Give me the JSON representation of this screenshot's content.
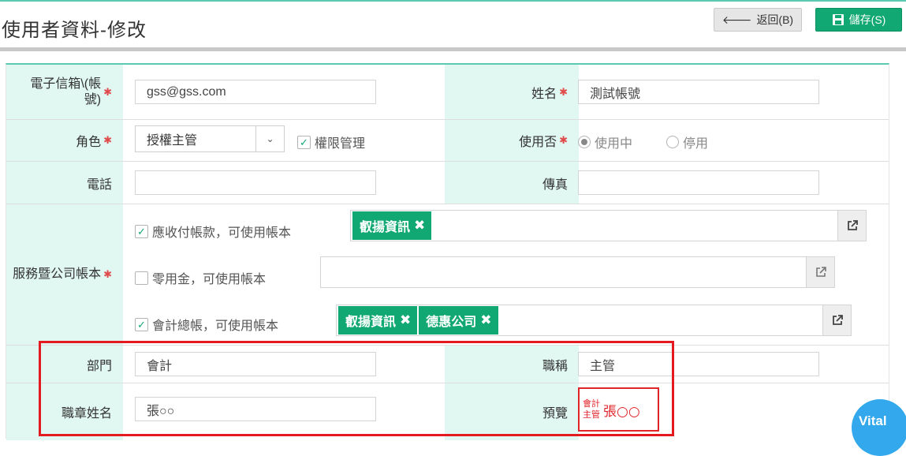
{
  "header": {
    "title": "使用者資料-修改",
    "back_label": "返回(B)",
    "save_label": "儲存(S)"
  },
  "form": {
    "email": {
      "label": "電子信箱\\(帳號)",
      "value": "gss@gss.com"
    },
    "name": {
      "label": "姓名",
      "value": "測試帳號"
    },
    "role": {
      "label": "角色",
      "value": "授權主管",
      "perm_label": "權限管理",
      "perm_checked": true
    },
    "status": {
      "label": "使用否",
      "options": [
        "使用中",
        "停用"
      ],
      "selected": "使用中"
    },
    "phone": {
      "label": "電話",
      "value": ""
    },
    "fax": {
      "label": "傳真",
      "value": ""
    },
    "services": {
      "label": "服務暨公司帳本",
      "items": [
        {
          "label": "應收付帳款，可使用帳本",
          "checked": true,
          "tags": [
            "叡揚資訊"
          ]
        },
        {
          "label": "零用金，可使用帳本",
          "checked": false,
          "tags": []
        },
        {
          "label": "會計總帳，可使用帳本",
          "checked": true,
          "tags": [
            "叡揚資訊",
            "德惠公司"
          ]
        }
      ]
    },
    "department": {
      "label": "部門",
      "value": "會計"
    },
    "job_title": {
      "label": "職稱",
      "value": "主管"
    },
    "stamp_name": {
      "label": "職章姓名",
      "value": "張○○"
    },
    "preview": {
      "label": "預覽",
      "stamp_line1": "會計",
      "stamp_line2": "主管",
      "stamp_name": "張○○"
    }
  },
  "badge": {
    "text": "Vital",
    "color": "#33a8ec"
  },
  "colors": {
    "accent": "#11a873",
    "label_bg": "#e1f7f1",
    "required": "#e04a4a",
    "highlight": "#e31a1f"
  }
}
